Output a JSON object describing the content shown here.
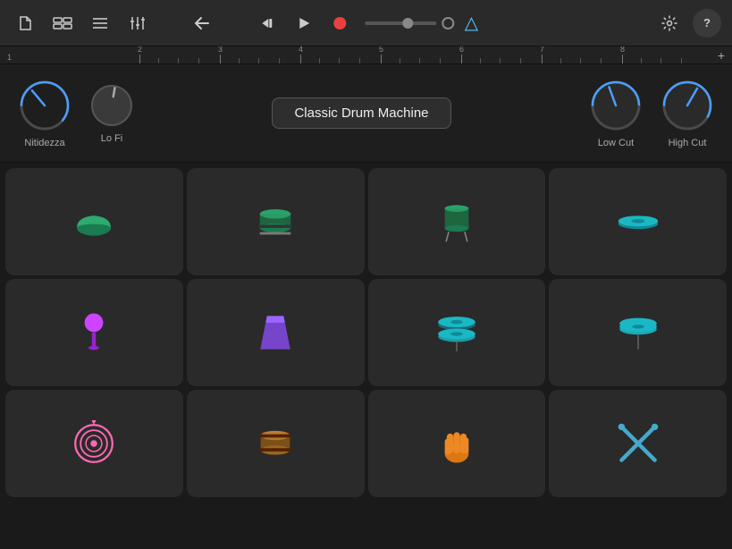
{
  "toolbar": {
    "icons": [
      {
        "name": "new-file-icon",
        "glyph": "📄"
      },
      {
        "name": "layout-icon",
        "glyph": "⊞"
      },
      {
        "name": "list-icon",
        "glyph": "≡"
      },
      {
        "name": "mixer-icon",
        "glyph": "⊟"
      }
    ],
    "transport": {
      "back_label": "⏮",
      "play_label": "▶",
      "record_label": "●"
    },
    "right_icons": [
      {
        "name": "settings-icon",
        "glyph": "⚙"
      },
      {
        "name": "help-icon",
        "glyph": "?"
      }
    ]
  },
  "ruler": {
    "marks": [
      "1",
      "2",
      "3",
      "4",
      "5",
      "6",
      "7",
      "8"
    ],
    "plus_label": "+"
  },
  "controls": {
    "knob1_label": "Nitidezza",
    "knob2_label": "Lo Fi",
    "preset_name": "Classic Drum Machine",
    "knob3_label": "Low Cut",
    "knob4_label": "High Cut"
  },
  "pads": {
    "rows": [
      [
        {
          "name": "kick-drum",
          "color": "#2daa6e",
          "type": "loaf"
        },
        {
          "name": "snare-drum",
          "color": "#2daa6e",
          "type": "snare"
        },
        {
          "name": "hi-tom",
          "color": "#2daa6e",
          "type": "tom"
        },
        {
          "name": "cymbal-right",
          "color": "#1ab8c4",
          "type": "cymbal"
        }
      ],
      [
        {
          "name": "maracas",
          "color": "#cc44ff",
          "type": "maraca"
        },
        {
          "name": "woodblock",
          "color": "#9966ff",
          "type": "block"
        },
        {
          "name": "hihat-open",
          "color": "#1ab8c4",
          "type": "hihat"
        },
        {
          "name": "hihat-closed",
          "color": "#1ab8c4",
          "type": "hihat2"
        }
      ],
      [
        {
          "name": "target-drum",
          "color": "#ff69b4",
          "type": "target"
        },
        {
          "name": "bongo",
          "color": "#cc8833",
          "type": "bongo"
        },
        {
          "name": "hand-clap",
          "color": "#ee8822",
          "type": "hand"
        },
        {
          "name": "crossed-sticks",
          "color": "#44aacc",
          "type": "sticks"
        }
      ]
    ]
  }
}
